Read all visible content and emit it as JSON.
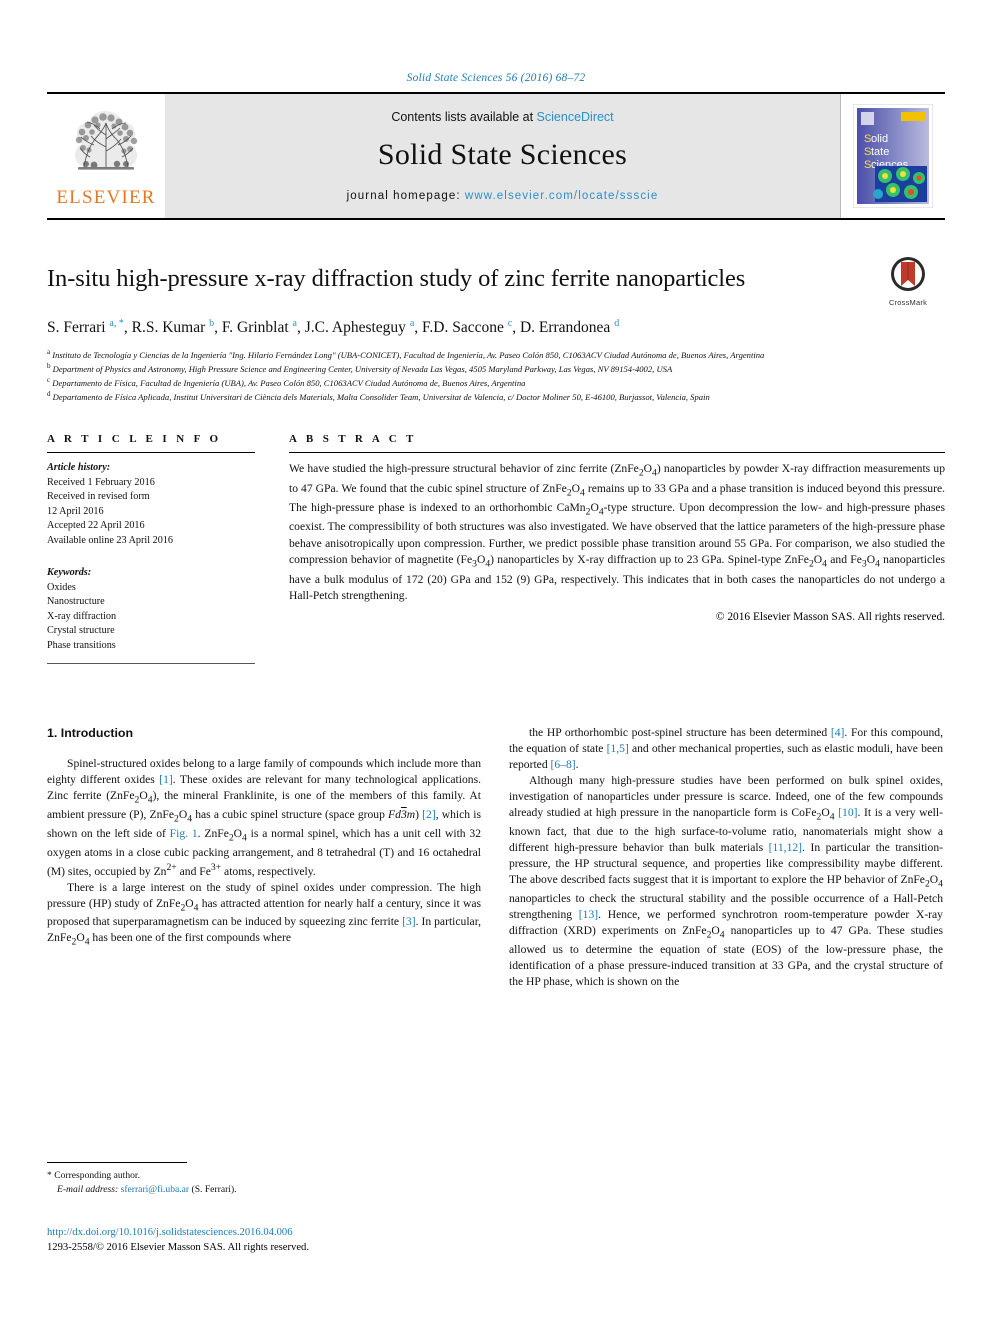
{
  "running_head": "Solid State Sciences 56 (2016) 68–72",
  "masthead": {
    "publisher_name": "ELSEVIER",
    "contents_prefix": "Contents lists available at ",
    "contents_link": "ScienceDirect",
    "journal_title": "Solid State Sciences",
    "homepage_prefix": "journal homepage: ",
    "homepage_url": "www.elsevier.com/locate/ssscie",
    "cover_title_line1": "Solid",
    "cover_title_line2": "State",
    "cover_title_line3": "Sciences"
  },
  "article": {
    "title": "In-situ high-pressure x-ray diffraction study of zinc ferrite nanoparticles",
    "crossmark_label": "CrossMark",
    "authors_html": "S. Ferrari <sup>a, *</sup>, R.S. Kumar <sup>b</sup>, F. Grinblat <sup>a</sup>, J.C. Aphesteguy <sup>a</sup>, F.D. Saccone <sup>c</sup>, D. Errandonea <sup>d</sup>",
    "affiliations": [
      "a Instituto de Tecnología y Ciencias de la Ingeniería \"Ing. Hilario Fernández Long\" (UBA-CONICET), Facultad de Ingeniería, Av. Paseo Colón 850, C1063ACV Ciudad Autónoma de, Buenos Aires, Argentina",
      "b Department of Physics and Astronomy, High Pressure Science and Engineering Center, University of Nevada Las Vegas, 4505 Maryland Parkway, Las Vegas, NV 89154-4002, USA",
      "c Departamento de Física, Facultad de Ingeniería (UBA), Av. Paseo Colón 850, C1063ACV Ciudad Autónoma de, Buenos Aires, Argentina",
      "d Departamento de Física Aplicada, Institut Universitari de Ciència dels Materials, Malta Consolider Team, Universitat de Valencia, c/ Doctor Moliner 50, E-46100, Burjassot, Valencia, Spain"
    ]
  },
  "article_info": {
    "heading": "A R T I C L E   I N F O",
    "history_label": "Article history:",
    "history": [
      "Received 1 February 2016",
      "Received in revised form",
      "12 April 2016",
      "Accepted 22 April 2016",
      "Available online 23 April 2016"
    ],
    "keywords_label": "Keywords:",
    "keywords": [
      "Oxides",
      "Nanostructure",
      "X-ray diffraction",
      "Crystal structure",
      "Phase transitions"
    ]
  },
  "abstract": {
    "heading": "A B S T R A C T",
    "text_html": "We have studied the high-pressure structural behavior of zinc ferrite (ZnFe<sub>2</sub>O<sub>4</sub>) nanoparticles by powder X-ray diffraction measurements up to 47 GPa. We found that the cubic spinel structure of ZnFe<sub>2</sub>O<sub>4</sub> remains up to 33 GPa and a phase transition is induced beyond this pressure. The high-pressure phase is indexed to an orthorhombic CaMn<sub>2</sub>O<sub>4</sub>-type structure. Upon decompression the low- and high-pressure phases coexist. The compressibility of both structures was also investigated. We have observed that the lattice parameters of the high-pressure phase behave anisotropically upon compression. Further, we predict possible phase transition around 55 GPa. For comparison, we also studied the compression behavior of magnetite (Fe<sub>3</sub>O<sub>4</sub>) nanoparticles by X-ray diffraction up to 23 GPa. Spinel-type ZnFe<sub>2</sub>O<sub>4</sub> and Fe<sub>3</sub>O<sub>4</sub> nanoparticles have a bulk modulus of 172 (20) GPa and 152 (9) GPa, respectively. This indicates that in both cases the nanoparticles do not undergo a Hall-Petch strengthening.",
    "copyright": "© 2016 Elsevier Masson SAS. All rights reserved."
  },
  "introduction": {
    "heading": "1. Introduction",
    "left_paragraphs_html": [
      "Spinel-structured oxides belong to a large family of compounds which include more than eighty different oxides <span class=\"reflink\">[1]</span>. These oxides are relevant for many technological applications. Zinc ferrite (ZnFe<sub>2</sub>O<sub>4</sub>), the mineral Franklinite, is one of the members of this family. At ambient pressure (P), ZnFe<sub>2</sub>O<sub>4</sub> has a cubic spinel structure (space group <i>Fd</i><span style=\"text-decoration:overline\"><i>3</i></span><i>m</i>) <span class=\"reflink\">[2]</span>, which is shown on the left side of <span class=\"reflink\">Fig. 1</span>. ZnFe<sub>2</sub>O<sub>4</sub> is a normal spinel, which has a unit cell with 32 oxygen atoms in a close cubic packing arrangement, and 8 tetrahedral (T) and 16 octahedral (M) sites, occupied by Zn<sup>2+</sup> and Fe<sup>3+</sup> atoms, respectively.",
      "There is a large interest on the study of spinel oxides under compression. The high pressure (HP) study of ZnFe<sub>2</sub>O<sub>4</sub> has attracted attention for nearly half a century, since it was proposed that superparamagnetism can be induced by squeezing zinc ferrite <span class=\"reflink\">[3]</span>. In particular, ZnFe<sub>2</sub>O<sub>4</sub> has been one of the first compounds where"
    ],
    "right_paragraphs_html": [
      "the HP orthorhombic post-spinel structure has been determined <span class=\"reflink\">[4]</span>. For this compound, the equation of state <span class=\"reflink\">[1,5]</span> and other mechanical properties, such as elastic moduli, have been reported <span class=\"reflink\">[6–8]</span>.",
      "Although many high-pressure studies have been performed on bulk spinel oxides, investigation of nanoparticles under pressure is scarce. Indeed, one of the few compounds already studied at high pressure in the nanoparticle form is CoFe<sub>2</sub>O<sub>4</sub> <span class=\"reflink\">[10]</span>. It is a very well-known fact, that due to the high surface-to-volume ratio, nanomaterials might show a different high-pressure behavior than bulk materials <span class=\"reflink\">[11,12]</span>. In particular the transition-pressure, the HP structural sequence, and properties like compressibility maybe different. The above described facts suggest that it is important to explore the HP behavior of ZnFe<sub>2</sub>O<sub>4</sub> nanoparticles to check the structural stability and the possible occurrence of a Hall-Petch strengthening <span class=\"reflink\">[13]</span>. Hence, we performed synchrotron room-temperature powder X-ray diffraction (XRD) experiments on ZnFe<sub>2</sub>O<sub>4</sub> nanoparticles up to 47 GPa. These studies allowed us to determine the equation of state (EOS) of the low-pressure phase, the identification of a phase pressure-induced transition at 33 GPa, and the crystal structure of the HP phase, which is shown on the"
    ]
  },
  "footnote": {
    "corresponding_label": "* Corresponding author.",
    "email_label": "E-mail address:",
    "email": "sferrari@fi.uba.ar",
    "email_suffix": "(S. Ferrari)."
  },
  "footer": {
    "doi": "http://dx.doi.org/10.1016/j.solidstatesciences.2016.04.006",
    "issn_line": "1293-2558/© 2016 Elsevier Masson SAS. All rights reserved."
  },
  "colors": {
    "link_blue": "#1a7bb9",
    "elsevier_orange": "#E87722",
    "masthead_gray": "#e6e6e6",
    "crossmark_red": "#c0392b"
  }
}
